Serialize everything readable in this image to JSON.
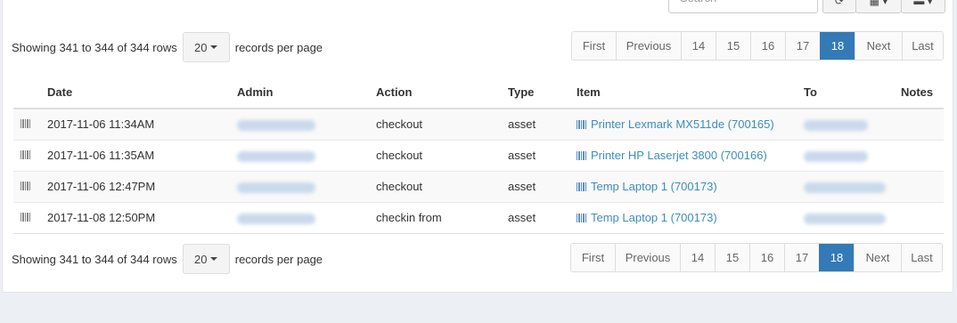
{
  "toolbar": {
    "search_placeholder": "Search"
  },
  "info_text": "Showing 341 to 344 of 344 rows",
  "page_size": "20",
  "records_per_page": "records per page",
  "pagination": [
    "First",
    "Previous",
    "14",
    "15",
    "16",
    "17",
    "18",
    "Next",
    "Last"
  ],
  "active_page": "18",
  "columns": [
    "Date",
    "Admin",
    "Action",
    "Type",
    "Item",
    "To",
    "Notes"
  ],
  "rows": [
    {
      "date": "2017-11-06 11:34AM",
      "action": "checkout",
      "type": "asset",
      "item": "Printer Lexmark MX511de (700165)"
    },
    {
      "date": "2017-11-06 11:35AM",
      "action": "checkout",
      "type": "asset",
      "item": "Printer HP Laserjet 3800 (700166)"
    },
    {
      "date": "2017-11-06 12:47PM",
      "action": "checkout",
      "type": "asset",
      "item": "Temp Laptop 1 (700173)"
    },
    {
      "date": "2017-11-08 12:50PM",
      "action": "checkin from",
      "type": "asset",
      "item": "Temp Laptop 1 (700173)"
    }
  ],
  "colors": {
    "accent": "#337ab7",
    "link": "#3c8dbc",
    "background": "#ecf0f5"
  }
}
